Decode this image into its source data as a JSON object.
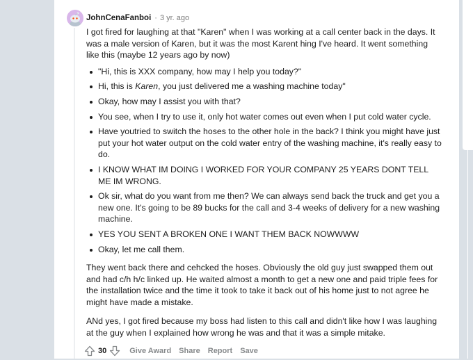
{
  "comment": {
    "username": "JohnCenaFanboi",
    "separator": "·",
    "time": "3 yr. ago",
    "score": "30",
    "intro": "I got fired for laughing at that \"Karen\" when I was working at a call center back in the days. It was a male version of Karen, but it was the most Karent hing I've heard. It went something like this (maybe 12 years ago by now)",
    "dialogue": [
      "\"Hi, this is XXX company, how may I help you today?\"",
      "Hi, this is Karen, you just delivered me a washing machine today\"",
      "Okay, how may I assist you with that?",
      "You see, when I try to use it, only hot water comes out even when I put cold water cycle.",
      "Have youtried to switch the hoses to the other hole in the back? I think you might have just put your hot water output on the cold water entry of the washing machine, it's really easy to do.",
      "I KNOW WHAT IM DOING I WORKED FOR YOUR COMPANY 25 YEARS DONT TELL ME IM WRONG.",
      "Ok sir, what do you want from me then? We can always send back the truck and get you a new one. It's going to be 89 bucks for the call and 3-4 weeks of delivery for a new washing machine.",
      "YES YOU SENT A BROKEN ONE I WANT THEM BACK NOWWWW",
      "Okay, let me call them."
    ],
    "paragraph2": "They went back there and cehcked the hoses. Obviously the old guy just swapped them out and had c/h h/c linked up. He waited almost a month to get a new one and paid triple fees for the installation twice and the time it took to take it back out of his home just to not agree he might have made a mistake.",
    "paragraph3": "ANd yes, I got fired because my boss had listen to this call and didn't like how I was laughing at the guy when I explained how wrong he was and that it was a simple mitake.",
    "actions": {
      "give_award": "Give Award",
      "share": "Share",
      "report": "Report",
      "save": "Save"
    }
  },
  "icons": {
    "avatar": "snoo-avatar-icon",
    "upvote": "upvote-arrow-icon",
    "downvote": "downvote-arrow-icon"
  },
  "colors": {
    "page_background": "#dae0e6",
    "card_background": "#ffffff",
    "text": "#1c1c1c",
    "muted_text": "#7c7c7c",
    "action_text": "#878a8c",
    "avatar_background": "#d9b7ea"
  }
}
